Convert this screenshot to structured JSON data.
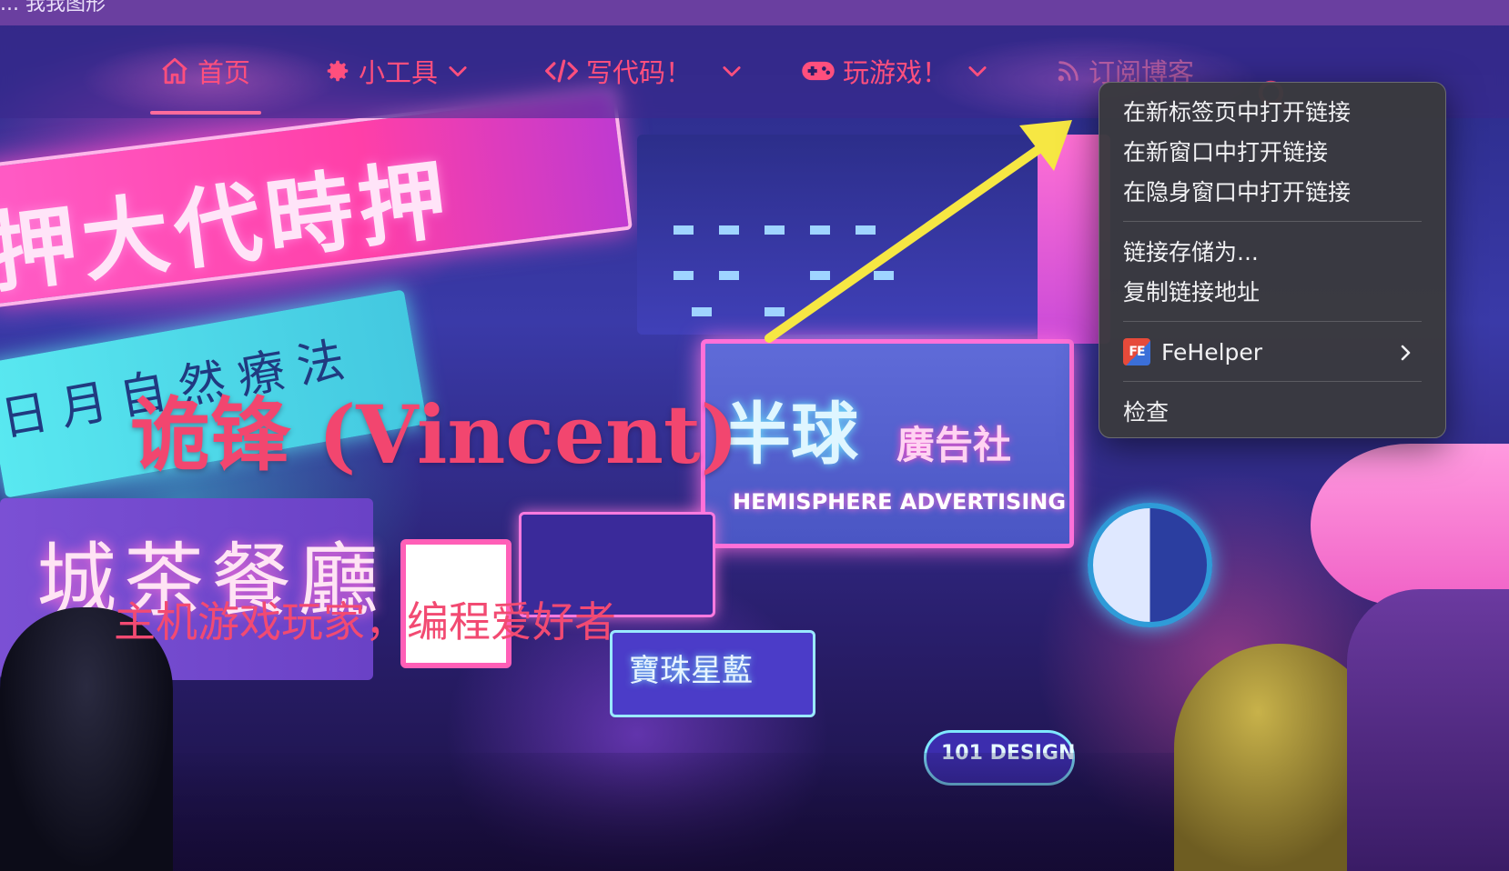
{
  "window": {
    "title_fragment": "... 我我图形"
  },
  "nav": {
    "items": [
      {
        "label": "首页",
        "icon": "home-icon"
      },
      {
        "label": "小工具",
        "icon": "gear-icon"
      },
      {
        "label": "写代码！",
        "icon": "code-icon"
      },
      {
        "label": "玩游戏！",
        "icon": "gamepad-icon"
      },
      {
        "label": "订阅博客",
        "icon": "rss-icon"
      }
    ],
    "search_icon": "search-icon",
    "accent_color": "#ff4f7d"
  },
  "hero": {
    "title": "诡锋 (Vincent)",
    "subtitle": "主机游戏玩家，编程爱好者",
    "signs": {
      "pink": "押大代時押",
      "cyan": "日月自然療法",
      "hemi_big": "半球",
      "hemi_small": "廣告社",
      "hemi_sub": "HEMISPHERE ADVERTISING",
      "teahouse": "城茶餐廳",
      "jewels": "寶珠星藍",
      "design": "101 DESIGN"
    },
    "arrow_color": "#f6e743"
  },
  "context_menu": {
    "items": [
      {
        "label": "在新标签页中打开链接"
      },
      {
        "label": "在新窗口中打开链接"
      },
      {
        "label": "在隐身窗口中打开链接"
      },
      {
        "label": "链接存储为..."
      },
      {
        "label": "复制链接地址"
      },
      {
        "label": "FeHelper",
        "icon": "fehelper-icon",
        "badge": "FE",
        "has_submenu": true
      },
      {
        "label": "检查"
      }
    ]
  }
}
